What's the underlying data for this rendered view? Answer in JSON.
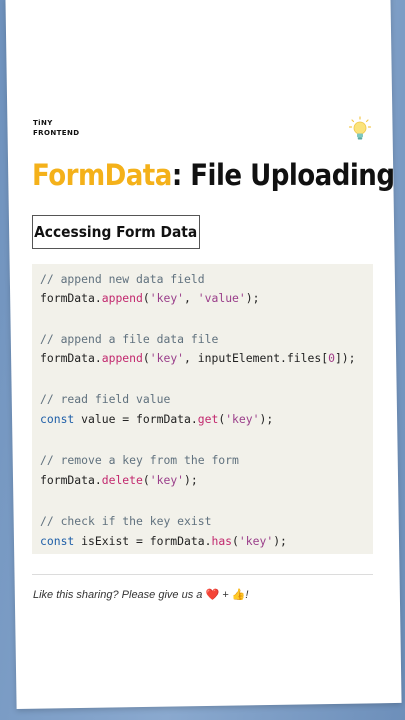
{
  "brand": {
    "line1": "TiNY",
    "line2": "FRONTEND"
  },
  "icon": "lightbulb-icon",
  "title": {
    "highlight": "FormData",
    "rest": ": File Uploading"
  },
  "section": {
    "label": "Accessing Form Data"
  },
  "code": {
    "c1": "// append new data field",
    "c2": "// append a file data file",
    "c3": "// read field value",
    "c4": "// remove a key from the form",
    "c5": "// check if the key exist",
    "formData": "formData",
    "dot": ".",
    "append": "append",
    "get": "get",
    "delete": "delete",
    "has": "has",
    "lparen": "(",
    "rparen": ")",
    "semi": ";",
    "rparen_semi": ");",
    "comma": ", ",
    "key": "'key'",
    "value_str": "'value'",
    "input_files": "inputElement.files",
    "lbr": "[",
    "rbr": "]",
    "zero": "0",
    "const": "const",
    "value_var": " value = ",
    "isexist_var": " isExist = "
  },
  "footer": {
    "text": "Like this sharing? Please give us a ",
    "heart": "❤️",
    "plus": " + ",
    "thumb": "👍",
    "end": "!"
  },
  "colors": {
    "accent": "#f4b11a",
    "keyword": "#1f5fa8",
    "method": "#c2286e",
    "string": "#9a3e8a"
  }
}
